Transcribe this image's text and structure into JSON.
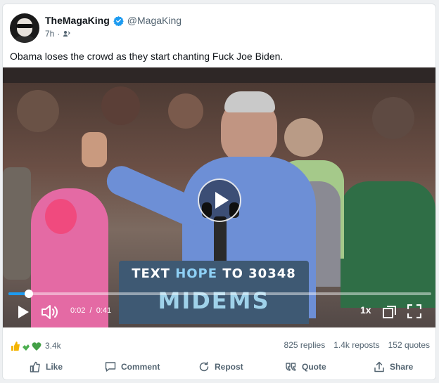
{
  "post": {
    "display_name": "TheMagaKing",
    "handle": "@MagaKing",
    "time": "7h",
    "separator": "·",
    "text": "Obama loses the crowd as they start chanting Fuck Joe Biden."
  },
  "video": {
    "podium_line1_a": "TEXT ",
    "podium_line1_b": "HOPE",
    "podium_line1_c": " TO 30348",
    "podium_line2": "MIDEMS",
    "current_time": "0:02",
    "time_separator": "/",
    "duration": "0:41",
    "speed": "1x",
    "progress_fraction": 0.049
  },
  "stats": {
    "reaction_count": "3.4k",
    "replies": "825 replies",
    "reposts": "1.4k reposts",
    "quotes": "152 quotes"
  },
  "actions": {
    "like": "Like",
    "comment": "Comment",
    "repost": "Repost",
    "quote": "Quote",
    "share": "Share"
  },
  "colors": {
    "accent": "#1d9bf0",
    "text": "#0f1419",
    "muted": "#536471"
  },
  "icons": [
    "verified-badge-icon",
    "audience-icon",
    "play-icon",
    "volume-icon",
    "pip-icon",
    "fullscreen-icon",
    "like-icon",
    "comment-icon",
    "repost-icon",
    "quote-icon",
    "share-icon"
  ]
}
